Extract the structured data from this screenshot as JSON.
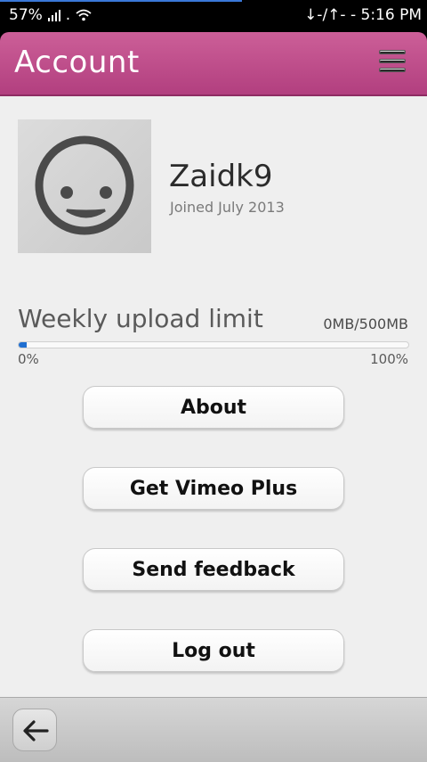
{
  "status_bar": {
    "battery": "57%",
    "data_indicator": "↓-/↑-",
    "time": "5:16 PM"
  },
  "header": {
    "title": "Account"
  },
  "profile": {
    "username": "Zaidk9",
    "joined": "Joined July 2013"
  },
  "upload": {
    "label": "Weekly upload limit",
    "usage": "0MB/500MB",
    "progress_fraction": 0.02,
    "min_label": "0%",
    "max_label": "100%"
  },
  "buttons": {
    "about": "About",
    "vimeo_plus": "Get Vimeo Plus",
    "feedback": "Send feedback",
    "logout": "Log out"
  },
  "colors": {
    "header_accent": "#c04c8a",
    "progress": "#1f6fd1"
  }
}
